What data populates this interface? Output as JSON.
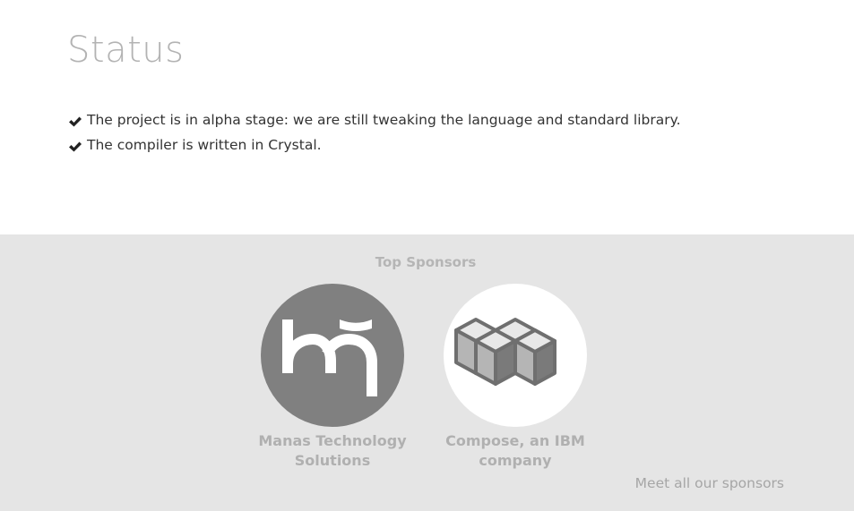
{
  "status": {
    "title": "Status",
    "items": [
      {
        "text": "The project is in alpha stage: we are still tweaking the language and standard library.",
        "icon": "check-icon"
      },
      {
        "text": "The compiler is written in Crystal.",
        "icon": "check-icon"
      }
    ]
  },
  "sponsors": {
    "heading": "Top Sponsors",
    "items": [
      {
        "name": "Manas Technology Solutions",
        "logo": "manas-logo",
        "logo_bg": "#808080"
      },
      {
        "name": "Compose, an IBM company",
        "logo": "compose-logo",
        "logo_bg": "#ffffff"
      }
    ],
    "meet_link": "Meet all our sponsors"
  },
  "colors": {
    "title": "#b3b3b3",
    "body_text": "#333333",
    "sponsors_bg": "#e5e5e5",
    "sponsor_text": "#b0b0b0"
  }
}
